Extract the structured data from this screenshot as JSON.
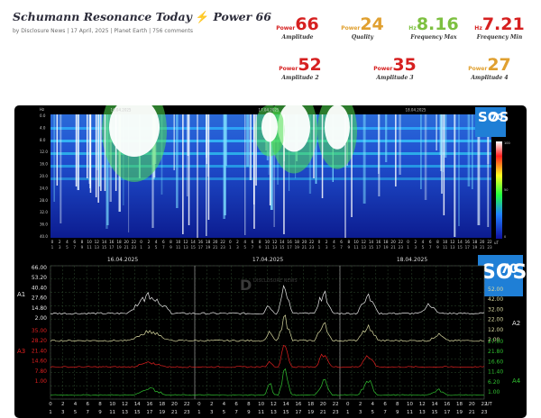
{
  "header": {
    "title_a": "Schumann Resonance Today",
    "title_b": "Power 66",
    "byline": "by Disclosure News | 17 April, 2025 | Planet Earth | 756 comments"
  },
  "stats": [
    {
      "label": "Power",
      "value": "66",
      "caption": "Amplitude",
      "color": "#d62020"
    },
    {
      "label": "Power",
      "value": "24",
      "caption": "Quality",
      "color": "#e0a030"
    },
    {
      "label": "Hz",
      "value": "8.16",
      "caption": "Frequency Max",
      "color": "#7dc040"
    },
    {
      "label": "Hz",
      "value": "7.21",
      "caption": "Frequency Min",
      "color": "#d62020"
    },
    {
      "label": "Power",
      "value": "52",
      "caption": "Amplitude 2",
      "color": "#d62020"
    },
    {
      "label": "Power",
      "value": "35",
      "caption": "Amplitude 3",
      "color": "#d62020"
    },
    {
      "label": "Power",
      "value": "27",
      "caption": "Amplitude 4",
      "color": "#e0a030"
    }
  ],
  "spectrogram": {
    "dates": [
      "16.04.2025",
      "17.04.2025",
      "18.04.2025"
    ],
    "hz_labels": [
      "Hz",
      "0.0",
      "4.0",
      "8.0",
      "12.0",
      "16.0",
      "20.0",
      "24.0",
      "28.0",
      "32.0",
      "36.0",
      "40.0"
    ],
    "colorbar_unit": "uT",
    "colorbar_labels": [
      "100",
      "50",
      "0"
    ]
  },
  "logo": {
    "line1": "SOS",
    "line2": "70"
  },
  "amplitude_chart": {
    "dates": [
      "16.04.2025",
      "17.04.2025",
      "18.04.2025"
    ],
    "left_a1_ticks": [
      "66.00",
      "53.20",
      "40.40",
      "27.60",
      "14.80",
      "2.00"
    ],
    "left_a3_ticks": [
      "35.00",
      "28.20",
      "21.40",
      "14.60",
      "7.80",
      "1.00"
    ],
    "right_a2_ticks": [
      "52.00",
      "42.00",
      "32.00",
      "22.00",
      "12.00",
      "2.00"
    ],
    "right_a4_ticks": [
      "27.00",
      "21.80",
      "16.60",
      "11.40",
      "6.20",
      "1.00"
    ],
    "axis_names": {
      "a1": "A1",
      "a2": "A2",
      "a3": "A3",
      "a4": "A4"
    },
    "watermark": "DISCLOSURE NEWS",
    "colors": {
      "a1": "#e8e8e8",
      "a2": "#d8d8a0",
      "a3": "#e02020",
      "a4": "#30c030"
    }
  },
  "time_axis": {
    "hours": [
      "0",
      "2",
      "4",
      "6",
      "8",
      "10",
      "12",
      "14",
      "16",
      "18",
      "20",
      "22",
      "0",
      "2",
      "4",
      "6",
      "8",
      "10",
      "12",
      "14",
      "16",
      "18",
      "20",
      "22",
      "0",
      "2",
      "4",
      "6",
      "8",
      "10",
      "12",
      "14",
      "16",
      "18",
      "20",
      "22"
    ],
    "unit": "UT"
  }
}
